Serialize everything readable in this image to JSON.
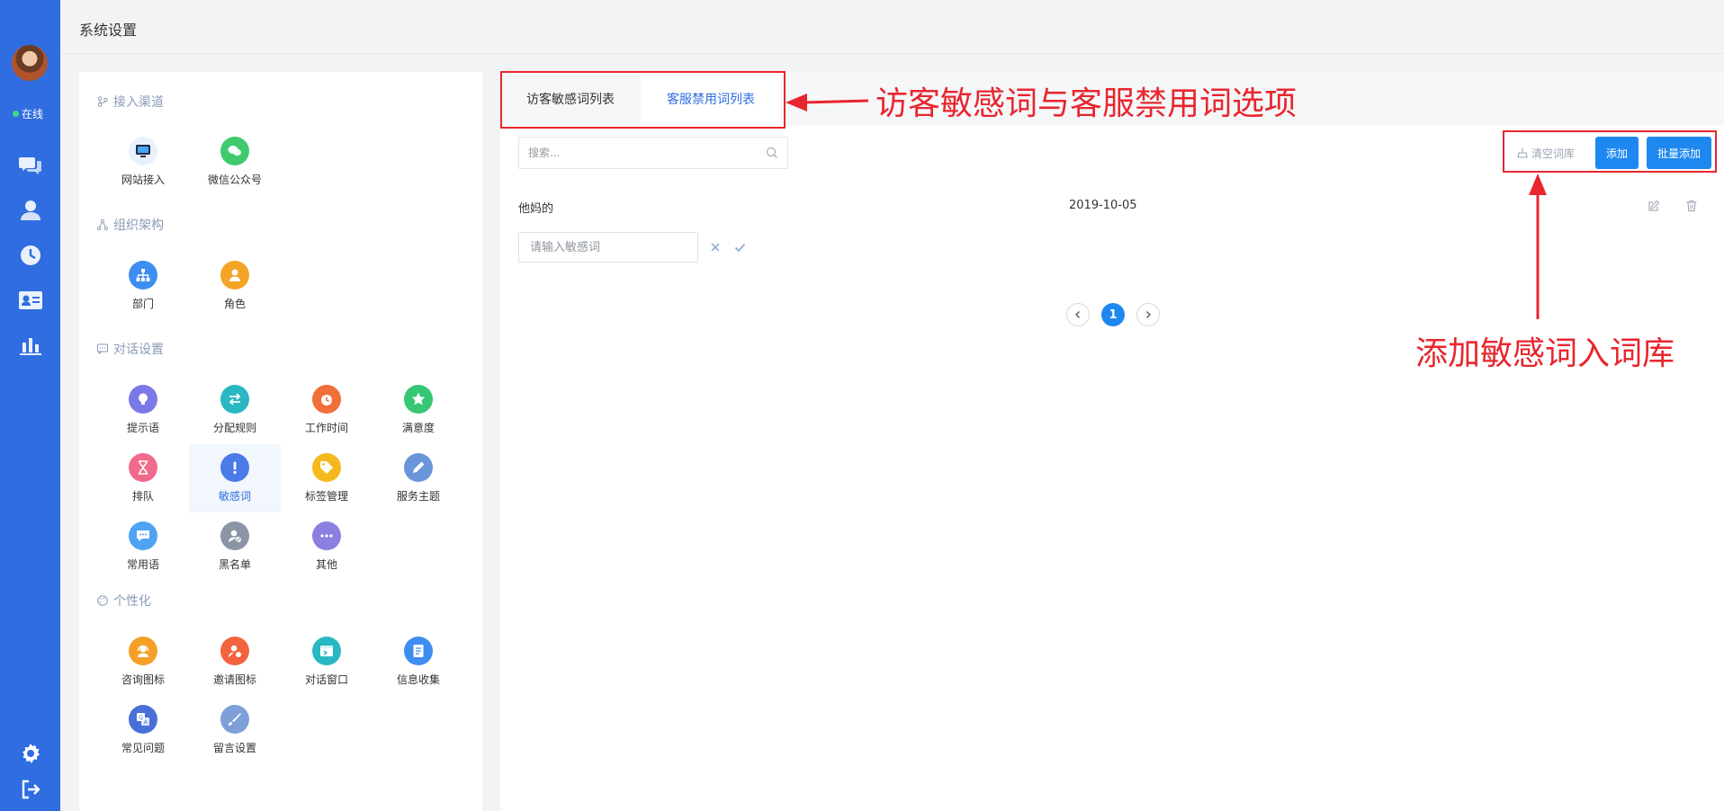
{
  "header": {
    "title": "系统设置"
  },
  "rail": {
    "status": "在线",
    "status_color": "#3ddc84",
    "nav_icons": [
      "chat-icon",
      "user-icon",
      "clock-icon",
      "id-card-icon",
      "bar-chart-icon"
    ],
    "bottom_icons": [
      "gear-icon",
      "logout-icon"
    ]
  },
  "settings": {
    "sections": [
      {
        "title": "接入渠道",
        "items": [
          "网站接入",
          "微信公众号"
        ]
      },
      {
        "title": "组织架构",
        "items": [
          "部门",
          "角色"
        ]
      },
      {
        "title": "对话设置",
        "items": [
          "提示语",
          "分配规则",
          "工作时间",
          "满意度",
          "排队",
          "敏感词",
          "标签管理",
          "服务主题",
          "常用语",
          "黑名单",
          "其他"
        ]
      },
      {
        "title": "个性化",
        "items": [
          "咨询图标",
          "邀请图标",
          "对话窗口",
          "信息收集",
          "常见问题",
          "留言设置"
        ]
      }
    ],
    "active_item": "敏感词"
  },
  "main": {
    "tabs": [
      {
        "label": "访客敏感词列表",
        "active": false
      },
      {
        "label": "客服禁用词列表",
        "active": true
      }
    ],
    "search_placeholder": "搜索...",
    "clear_label": "清空词库",
    "add_label": "添加",
    "batch_add_label": "批量添加",
    "rows": [
      {
        "word": "他妈的",
        "date": "2019-10-05"
      }
    ],
    "new_word_placeholder": "请输入敏感词",
    "pagination": {
      "current": "1"
    }
  },
  "annotations": {
    "tabs_note": "访客敏感词与客服禁用词选项",
    "buttons_note": "添加敏感词入词库",
    "color": "#e8262e"
  },
  "colors": {
    "primary": "#2f6de0",
    "button": "#1e88f0"
  }
}
